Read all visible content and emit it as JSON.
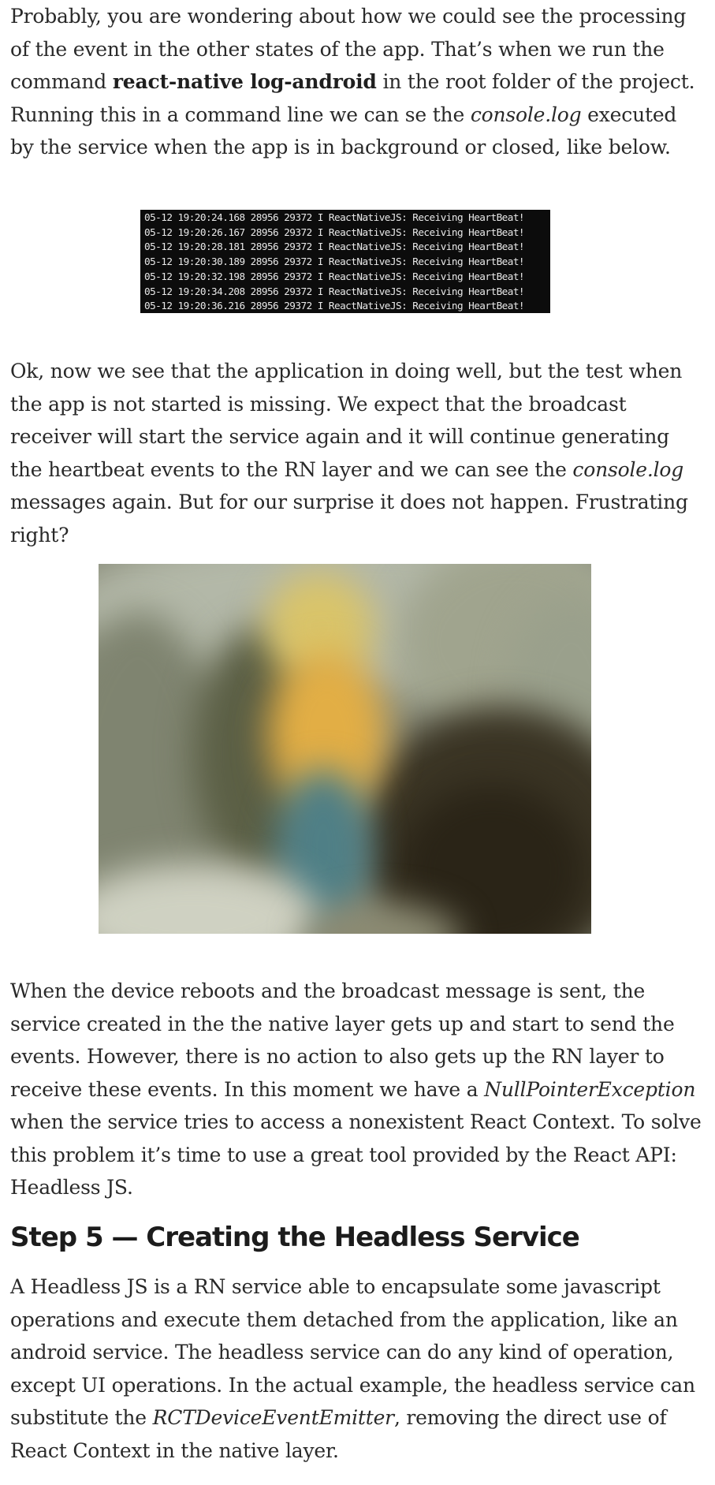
{
  "article": {
    "paragraph1": {
      "t1": "Probably, you are wondering about how we could see the processing of the event in the other states of the app. That’s when we run the command ",
      "cmd": "react-native log-android",
      "t2": " in the root folder of the project. Running this in a command line we can se the ",
      "em": "console.log",
      "t3": " executed by the service when the app is in background or closed, like below."
    },
    "log_lines": [
      "05-12 19:20:24.168 28956 29372 I ReactNativeJS: Receiving HeartBeat!",
      "05-12 19:20:26.167 28956 29372 I ReactNativeJS: Receiving HeartBeat!",
      "05-12 19:20:28.181 28956 29372 I ReactNativeJS: Receiving HeartBeat!",
      "05-12 19:20:30.189 28956 29372 I ReactNativeJS: Receiving HeartBeat!",
      "05-12 19:20:32.198 28956 29372 I ReactNativeJS: Receiving HeartBeat!",
      "05-12 19:20:34.208 28956 29372 I ReactNativeJS: Receiving HeartBeat!",
      "05-12 19:20:36.216 28956 29372 I ReactNativeJS: Receiving HeartBeat!"
    ],
    "paragraph2": {
      "t1": "Ok, now we see that the application in doing well, but the test when the app is not started is missing. We expect that the broadcast receiver will start the service again and it will continue generating the heartbeat events to the RN layer and we can see the ",
      "em": "console.log",
      "t2": " messages again. But for our surprise it does not happen. Frustrating right?"
    },
    "paragraph3": {
      "t1": "When the device reboots and the broadcast message is sent, the service created in the the native layer gets up and start to send the events. However, there is no action to also gets up the RN layer to receive these events. In this moment we have a ",
      "em": "NullPointerException",
      "t2": " when the service tries to access a nonexistent React Context. To solve this problem it’s time to use a great tool provided by the React API: Headless JS."
    },
    "heading": "Step 5 — Creating the Headless Service",
    "paragraph4": {
      "t1": "A Headless JS is a RN service able to encapsulate some javascript operations and execute them detached from the application, like an android service. The headless service can do any kind of operation, except UI operations. In the actual example, the headless service can substitute the ",
      "em": "RCTDeviceEventEmitter",
      "t2": ", removing the direct use of React Context in the native layer."
    }
  },
  "colors": {
    "text": "#292929",
    "log_background": "#0c0c0c",
    "log_text": "#e9e9e9"
  }
}
